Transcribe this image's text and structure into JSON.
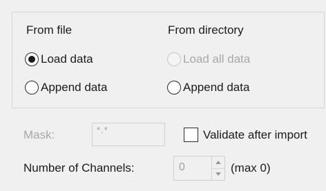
{
  "from_file": {
    "heading": "From file",
    "load_data_label": "Load data",
    "append_data_label": "Append data",
    "selected": "load_data"
  },
  "from_directory": {
    "heading": "From directory",
    "load_all_data_label": "Load all data",
    "append_data_label": "Append data",
    "load_all_data_enabled": false
  },
  "mask": {
    "label": "Mask:",
    "value": "*.*",
    "enabled": false
  },
  "validate": {
    "label": "Validate after import",
    "checked": false
  },
  "channels": {
    "label": "Number of Channels:",
    "value": "0",
    "max_text": "(max 0)",
    "enabled": false
  },
  "icons": {
    "spin_up": "chevron-up-icon",
    "spin_down": "chevron-down-icon"
  }
}
